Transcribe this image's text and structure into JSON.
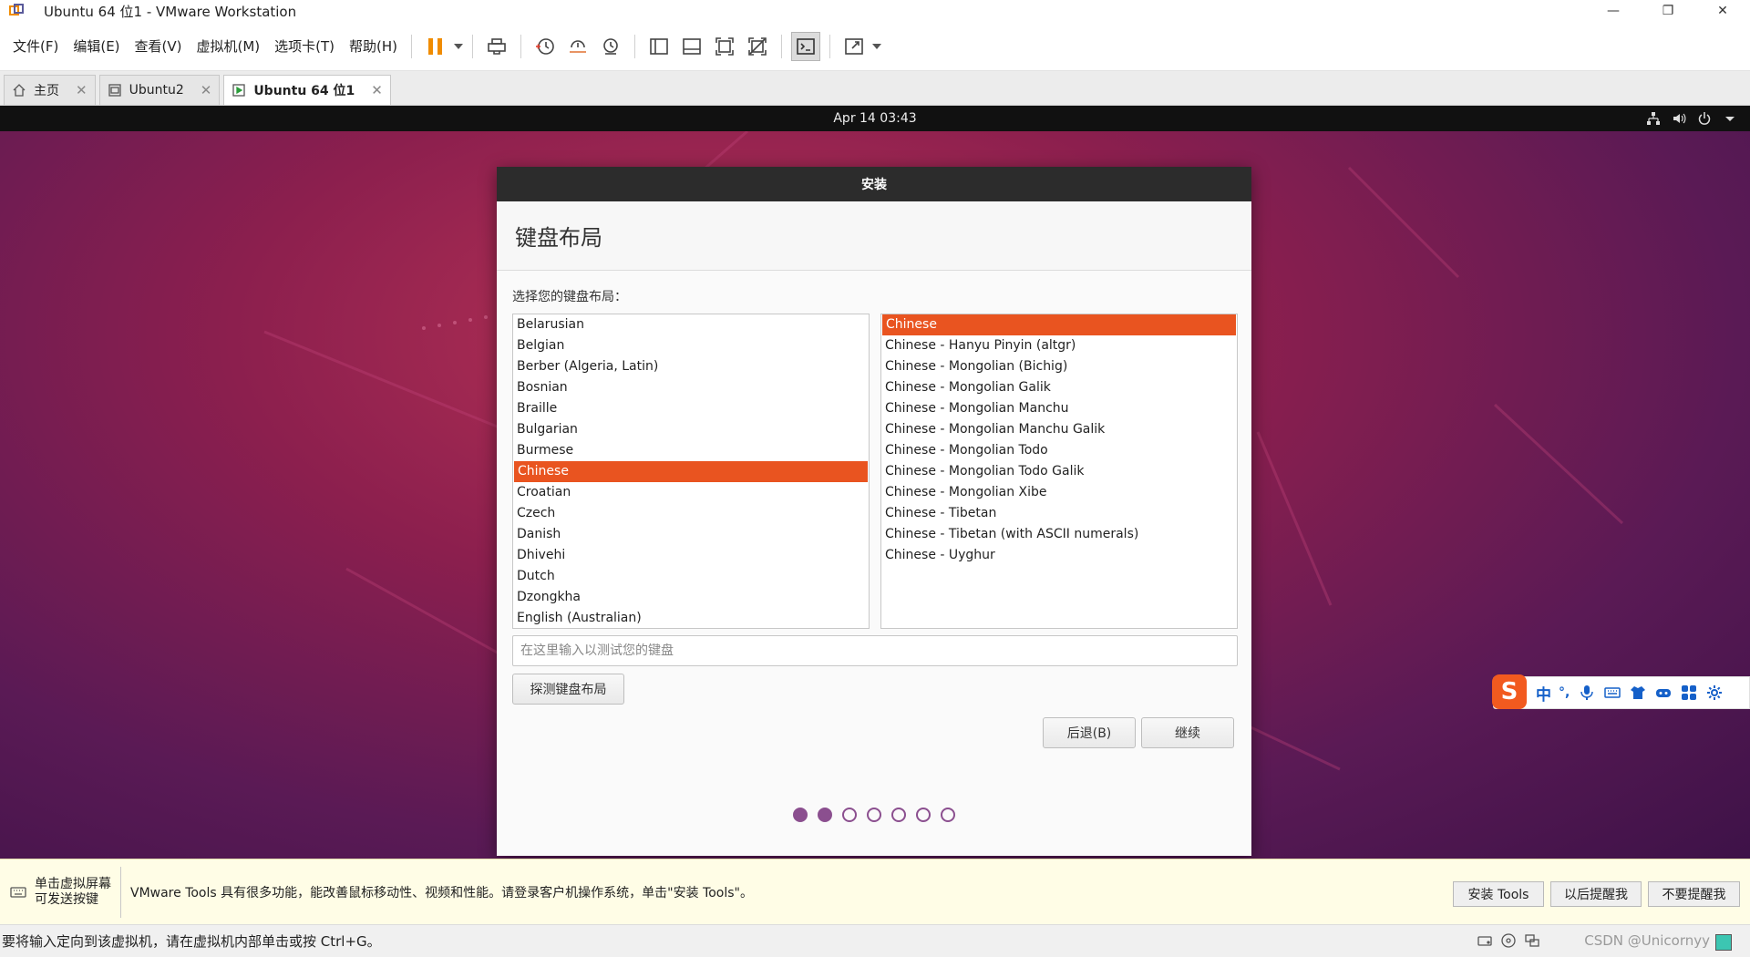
{
  "window": {
    "title": "Ubuntu 64 位1 - VMware Workstation",
    "controls": [
      "—",
      "❐",
      "✕"
    ]
  },
  "menu": [
    "文件(F)",
    "编辑(E)",
    "查看(V)",
    "虚拟机(M)",
    "选项卡(T)",
    "帮助(H)"
  ],
  "toolbar_icons": [
    "pause-icon",
    "send-ctrl-alt-del-icon",
    "snapshot-icon",
    "revert-snapshot-icon",
    "snapshot-manager-icon",
    "sidebar-icon",
    "thumbnail-bar-icon",
    "fullscreen-icon",
    "unity-icon",
    "console-icon",
    "stretch-icon"
  ],
  "tabs": [
    {
      "label": "主页",
      "icon": "home-icon",
      "active": false
    },
    {
      "label": "Ubuntu2",
      "icon": "vm-icon",
      "active": false
    },
    {
      "label": "Ubuntu 64 位1",
      "icon": "vm-running-icon",
      "active": true
    }
  ],
  "guest": {
    "clock": "Apr 14  03:43",
    "tray_icons": [
      "network-icon",
      "volume-icon",
      "power-icon",
      "chevron-down-icon"
    ]
  },
  "installer": {
    "window_title": "安装",
    "heading": "键盘布局",
    "prompt": "选择您的键盘布局：",
    "layouts": [
      "Belarusian",
      "Belgian",
      "Berber (Algeria, Latin)",
      "Bosnian",
      "Braille",
      "Bulgarian",
      "Burmese",
      "Chinese",
      "Croatian",
      "Czech",
      "Danish",
      "Dhivehi",
      "Dutch",
      "Dzongkha",
      "English (Australian)"
    ],
    "selected_layout": "Chinese",
    "variants": [
      "Chinese",
      "Chinese - Hanyu Pinyin (altgr)",
      "Chinese - Mongolian (Bichig)",
      "Chinese - Mongolian Galik",
      "Chinese - Mongolian Manchu",
      "Chinese - Mongolian Manchu Galik",
      "Chinese - Mongolian Todo",
      "Chinese - Mongolian Todo Galik",
      "Chinese - Mongolian Xibe",
      "Chinese - Tibetan",
      "Chinese - Tibetan (with ASCII numerals)",
      "Chinese - Uyghur"
    ],
    "selected_variant": "Chinese",
    "test_placeholder": "在这里输入以测试您的键盘",
    "detect_label": "探测键盘布局",
    "back_label": "后退(B)",
    "continue_label": "继续",
    "steps_total": 7,
    "steps_done": 2
  },
  "ime": {
    "label": "中",
    "punct": "°,"
  },
  "notice": {
    "hint": "单击虚拟屏幕\n可发送按键",
    "message": "VMware Tools 具有很多功能，能改善鼠标移动性、视频和性能。请登录客户机操作系统，单击\"安装 Tools\"。",
    "install_label": "安装 Tools",
    "later_label": "以后提醒我",
    "never_label": "不要提醒我"
  },
  "status": {
    "text": "要将输入定向到该虚拟机，请在虚拟机内部单击或按 Ctrl+G。",
    "watermark": "CSDN @Unicornyy"
  },
  "colors": {
    "ubuntu_orange": "#e95420",
    "aubergine_dot": "#8b4f8f",
    "vmware_orange": "#f08c00"
  }
}
